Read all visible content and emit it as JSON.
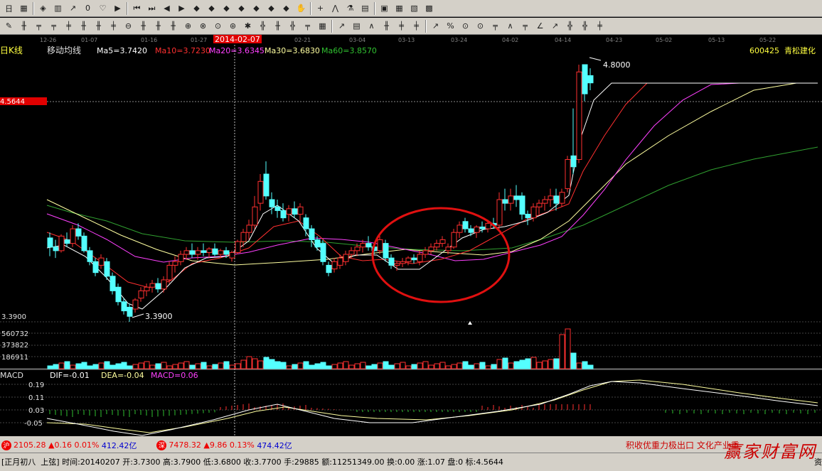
{
  "toolbar1": {
    "icons": [
      "calendar-icon",
      "grid-icon",
      "book-icon",
      "bars-icon",
      "chart-up-icon",
      "digit-icon",
      "eye-icon",
      "play-icon",
      "first-icon",
      "last-icon",
      "left-icon",
      "right-icon",
      "up-diamond-icon",
      "up2-diamond-icon",
      "down-diamond-icon",
      "down2-diamond-icon",
      "plus-diamond-icon",
      "minus-diamond-icon",
      "cross-diamond-icon",
      "hand-icon",
      "crosshair-icon",
      "zigzag-icon",
      "flask-icon",
      "film-icon",
      "calc-icon",
      "save-icon",
      "print-icon",
      "photo-icon"
    ],
    "glyphs": [
      "日",
      "▦",
      "◈",
      "▥",
      "↗",
      "0",
      "♡",
      "▶",
      "⏮",
      "⏭",
      "◀",
      "▶",
      "◆",
      "◆",
      "◆",
      "◆",
      "◆",
      "◆",
      "◆",
      "✋",
      "+",
      "⋀",
      "⚗",
      "▤",
      "▣",
      "▦",
      "▧",
      "▩"
    ]
  },
  "toolbar2": {
    "glyphs": [
      "✎",
      "╫",
      "╤",
      "╤",
      "╪",
      "╫",
      "╫",
      "╪",
      "⊖",
      "╫",
      "╫",
      "╫",
      "⊕",
      "⊗",
      "⊙",
      "⊛",
      "✱",
      "╬",
      "╫",
      "╬",
      "╤",
      "▦",
      "↗",
      "▤",
      "∧",
      "╫",
      "╪",
      "╪",
      "↗",
      "%",
      "⊙",
      "⊙",
      "╤",
      "∧",
      "╤",
      "∠",
      "↗",
      "╬",
      "╬",
      "╪"
    ]
  },
  "chart": {
    "period_label": "日K线",
    "indicator_name": "移动均线",
    "ma5": "Ma5=3.7420",
    "ma10": "Ma10=3.7230",
    "ma20": "Ma20=3.6345",
    "ma30": "Ma30=3.6830",
    "ma60": "Ma60=3.8570",
    "stock_code": "600425",
    "stock_name": "青松建化",
    "crosshair_date": "2014-02-07",
    "price_tag": "4.5644",
    "high_label": "4.8000",
    "low_label": "3.3900",
    "low_axis": "3.3900",
    "vol_labels": [
      "560732",
      "373822",
      "186911"
    ],
    "macd_name": "MACD",
    "dif": "DIF=-0.01",
    "dea": "DEA=-0.04",
    "macd_val": "MACD=0.06",
    "macd_axis": [
      "0.19",
      "0.11",
      "0.03",
      "-0.05"
    ],
    "dates": [
      "12-26",
      "01-07",
      "01-16",
      "01-27",
      "",
      "02-12",
      "02-21",
      "03-04",
      "03-13",
      "03-24",
      "04-02",
      "04-14",
      "04-23",
      "05-02",
      "05-13",
      "05-22"
    ],
    "colors": {
      "up": "#ff3030",
      "down": "#54ffff",
      "ma5": "#ffffff",
      "ma10": "#ff3030",
      "ma20": "#ff40ff",
      "ma30": "#ffffa0",
      "ma60": "#30a030"
    }
  },
  "status": {
    "sh_index": "2105.28",
    "sh_change": "▲0.16",
    "sh_pct": "0.01%",
    "sh_amount": "412.42亿",
    "sh_badge": "沪",
    "sz_badge": "深",
    "sz_index": "7478.32",
    "sz_change": "▲9.86",
    "sz_pct": "0.13%",
    "sz_amount": "474.42亿",
    "scroll_news": "积收优重力极出口 文化产业重组",
    "lunar": "[正月初八",
    "moon": "上弦]",
    "time": "时间:20140207",
    "open": "开:3.7300",
    "high": "高:3.7900",
    "low": "低:3.6800",
    "close": "收:3.7700",
    "hand": "手:29885",
    "amount": "额:11251349.00",
    "turnover": "换:0.00",
    "rise": "涨:1.07",
    "pan": "盘:0",
    "mark": "标:4.5644",
    "logo": "赢家财富网",
    "tail": "资"
  }
}
